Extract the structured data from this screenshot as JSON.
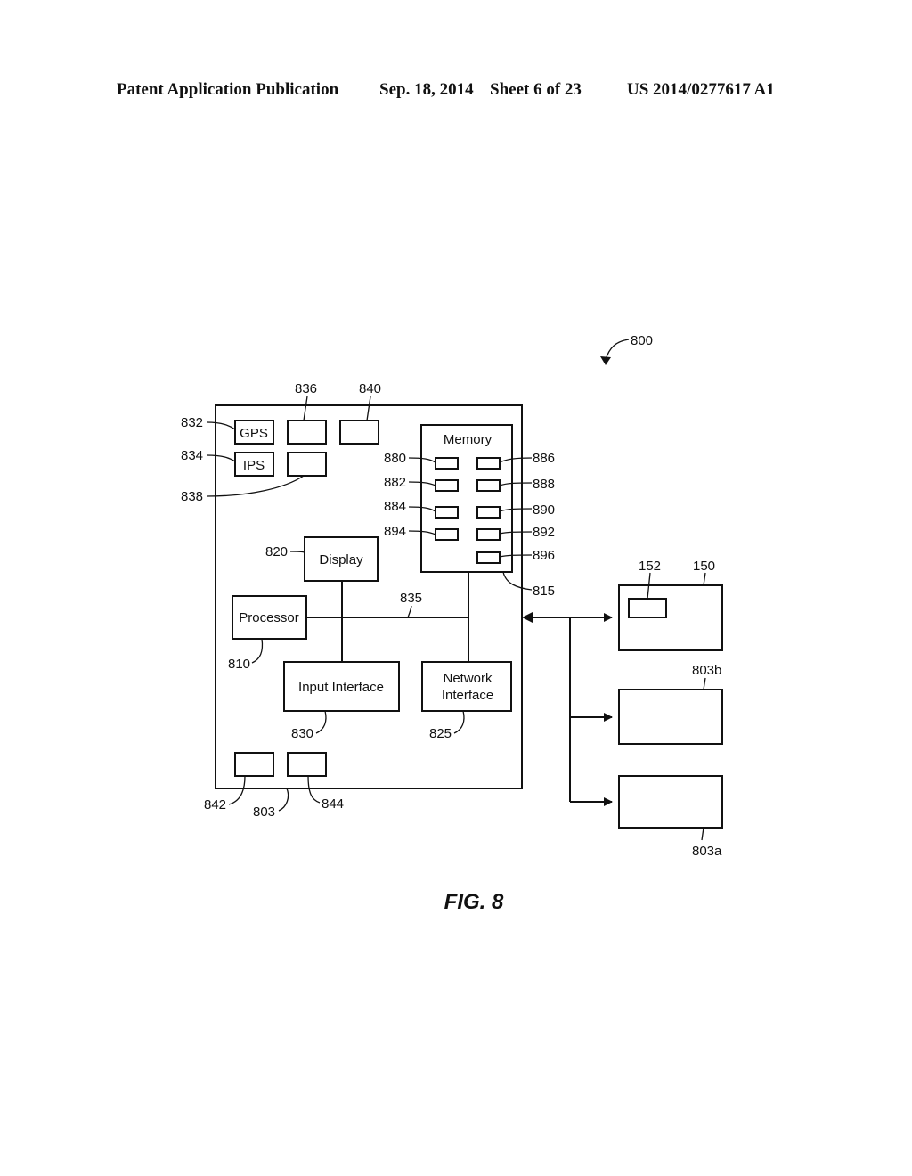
{
  "header": {
    "publication": "Patent Application Publication",
    "date": "Sep. 18, 2014",
    "sheet": "Sheet 6 of 23",
    "number": "US 2014/0277617 A1"
  },
  "figure": {
    "caption": "FIG. 8",
    "ref_system": "800",
    "device": {
      "ref": "803",
      "components": {
        "gps": {
          "label": "GPS",
          "ref": "832"
        },
        "ips": {
          "label": "IPS",
          "ref": "834"
        },
        "sensor_836": {
          "ref": "836"
        },
        "sensor_840": {
          "ref": "840"
        },
        "sensor_838": {
          "ref": "838"
        },
        "display": {
          "label": "Display",
          "ref": "820"
        },
        "processor": {
          "label": "Processor",
          "ref": "810"
        },
        "input_interface": {
          "label": "Input Interface",
          "ref": "830"
        },
        "network_interface": {
          "label_line1": "Network",
          "label_line2": "Interface",
          "ref": "825"
        },
        "bus": {
          "ref": "835"
        },
        "memory": {
          "label": "Memory",
          "ref": "815",
          "slots_left": [
            "880",
            "882",
            "884",
            "894"
          ],
          "slots_right": [
            "886",
            "888",
            "890",
            "892",
            "896"
          ]
        },
        "port_842": {
          "ref": "842"
        },
        "port_844": {
          "ref": "844"
        }
      }
    },
    "external": {
      "server": {
        "ref": "150",
        "inner_ref": "152"
      },
      "device_b": {
        "ref": "803b"
      },
      "device_a": {
        "ref": "803a"
      }
    }
  }
}
